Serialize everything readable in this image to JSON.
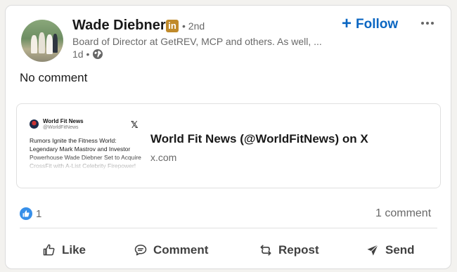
{
  "post": {
    "author": {
      "name": "Wade Diebner",
      "badge": "in",
      "degree": "• 2nd",
      "headline": "Board of Director at GetREV, MCP and others. As well, ...",
      "timestamp": "1d •"
    },
    "follow_label": "Follow",
    "follow_plus": "+",
    "text": "No comment",
    "link_preview": {
      "thumb_account_name": "World Fit News",
      "thumb_account_handle": "@WorldFitNews",
      "thumb_x": "𝕏",
      "thumb_text": "Rumors Ignite the Fitness World: Legendary Mark Mastrov and Investor Powerhouse Wade Diebner Set to Acquire CrossFit with A-List Celebrity Firepower!",
      "title": "World Fit News (@WorldFitNews) on X",
      "domain": "x.com"
    },
    "reactions_count": "1",
    "comments_count": "1 comment"
  },
  "actions": {
    "like": "Like",
    "comment": "Comment",
    "repost": "Repost",
    "send": "Send"
  },
  "colors": {
    "accent": "#0a66c2",
    "like_bubble": "#378fe9",
    "premium_badge": "#c08a2a"
  }
}
